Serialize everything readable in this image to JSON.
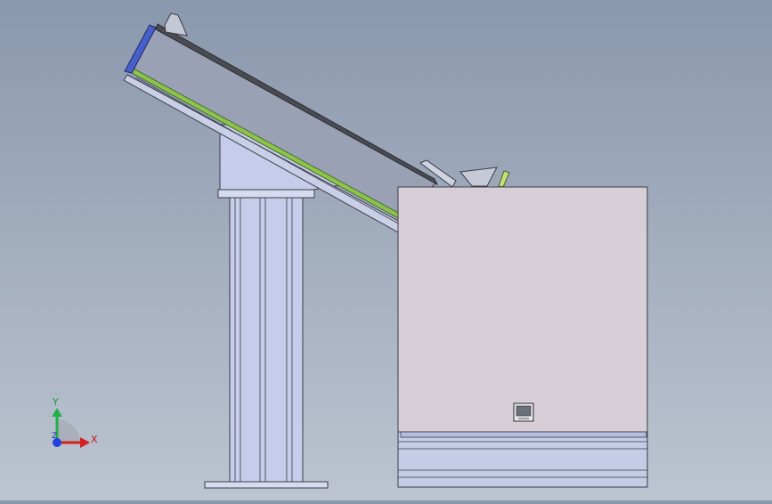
{
  "viewport": {
    "background_top": "#8a98ad",
    "background_bottom": "#bcc4d0"
  },
  "model": {
    "colors": {
      "conveyor_body": "#9aa1b4",
      "conveyor_belt_top": "#4a4c52",
      "conveyor_rail": "#8cc34a",
      "conveyor_end_cap": "#4760c8",
      "stand": "#c6ccea",
      "cabinet": "#d8ced8",
      "outline": "#3a3d48"
    },
    "control_panel_icon": "display-panel-icon"
  },
  "triad": {
    "x_label": "X",
    "y_label": "Y",
    "z_label": "Z",
    "x_color": "#d42020",
    "y_color": "#22b04a",
    "z_color": "#2040e0"
  }
}
